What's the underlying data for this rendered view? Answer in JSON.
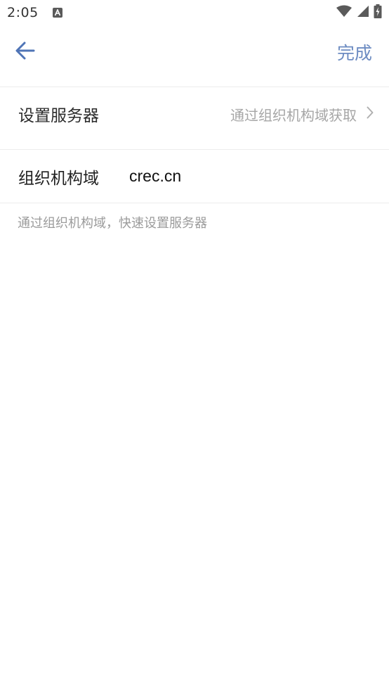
{
  "status_bar": {
    "time": "2:05",
    "notification_icon": "a-badge-icon",
    "icons": [
      "wifi-icon",
      "cellular-signal-icon",
      "battery-charging-icon"
    ]
  },
  "toolbar": {
    "back_icon": "arrow-left-icon",
    "done_label": "完成"
  },
  "server_row": {
    "title": "设置服务器",
    "value": "通过组织机构域获取",
    "chevron_icon": "chevron-right-icon"
  },
  "domain_row": {
    "label": "组织机构域",
    "value": "crec.cn"
  },
  "hint": "通过组织机构域，快速设置服务器",
  "colors": {
    "accent": "#6d8cc2",
    "back_arrow": "#4f74b6",
    "divider": "#ececec",
    "secondary_text": "#a6a6a6"
  }
}
